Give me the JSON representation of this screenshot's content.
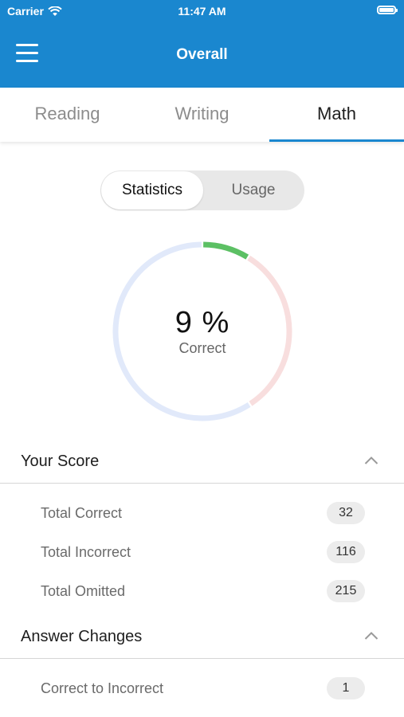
{
  "status_bar": {
    "carrier": "Carrier",
    "time": "11:47 AM"
  },
  "nav": {
    "title": "Overall",
    "menu_icon": "hamburger-icon"
  },
  "tabs": [
    {
      "label": "Reading",
      "active": false
    },
    {
      "label": "Writing",
      "active": false
    },
    {
      "label": "Math",
      "active": true
    }
  ],
  "segmented": {
    "options": [
      "Statistics",
      "Usage"
    ],
    "selected": "Statistics"
  },
  "donut": {
    "percent_text": "9 %",
    "caption": "Correct",
    "fractions": {
      "correct": 0.088,
      "incorrect": 0.32,
      "omitted": 0.592
    },
    "colors": {
      "correct": "#5cc064",
      "incorrect": "#f8dede",
      "omitted": "#e1e9fa"
    }
  },
  "sections": [
    {
      "title": "Your Score",
      "expanded": true,
      "rows": [
        {
          "label": "Total Correct",
          "value": "32"
        },
        {
          "label": "Total Incorrect",
          "value": "116"
        },
        {
          "label": "Total Omitted",
          "value": "215"
        }
      ]
    },
    {
      "title": "Answer Changes",
      "expanded": true,
      "rows": [
        {
          "label": "Correct to Incorrect",
          "value": "1"
        }
      ]
    }
  ],
  "colors": {
    "header_bg": "#1a87cf",
    "tab_underline": "#1a87cf"
  }
}
